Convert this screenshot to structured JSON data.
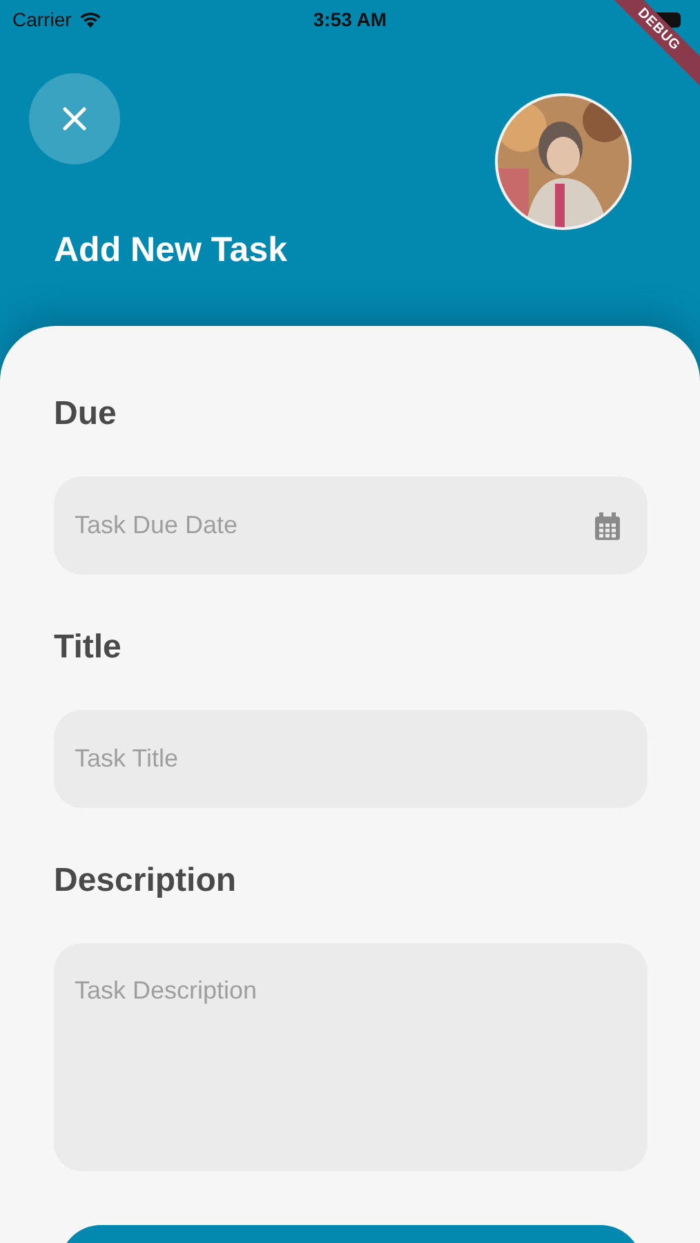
{
  "status_bar": {
    "carrier": "Carrier",
    "time": "3:53 AM"
  },
  "debug_banner": {
    "label": "DEBUG"
  },
  "header": {
    "title": "Add New Task"
  },
  "form": {
    "fields": [
      {
        "label": "Due",
        "placeholder": "Task Due Date",
        "kind": "date"
      },
      {
        "label": "Title",
        "placeholder": "Task Title",
        "kind": "text"
      },
      {
        "label": "Description",
        "placeholder": "Task Description",
        "kind": "multiline"
      }
    ]
  }
}
